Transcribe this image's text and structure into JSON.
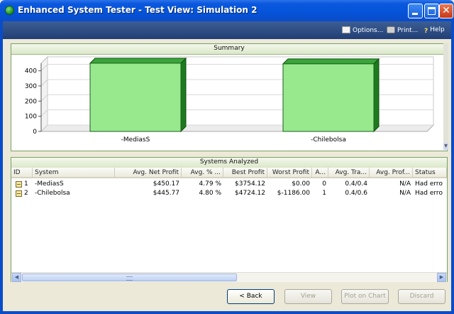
{
  "window": {
    "title": "Enhanced System Tester - Test View: Simulation 2",
    "controls": {
      "minimize_icon": "minimize-icon",
      "maximize_icon": "maximize-icon",
      "close_icon": "close-icon",
      "close_glyph": "✕"
    }
  },
  "toolbar": {
    "options_label": "Options...",
    "print_label": "Print...",
    "help_label": "Help",
    "help_glyph": "?"
  },
  "summary": {
    "header": "Summary"
  },
  "chart_data": {
    "type": "bar",
    "categories": [
      "-MediasS",
      "-Chilebolsa"
    ],
    "values": [
      450.17,
      445.77
    ],
    "ylim": [
      0,
      450
    ],
    "yticks": [
      0,
      100,
      200,
      300,
      400
    ],
    "grid": true,
    "bar_color": "#98e98e",
    "bar_side_color": "#1e7a1e"
  },
  "analyzed": {
    "header": "Systems Analyzed",
    "columns": [
      "ID",
      "System",
      "Avg. Net Profit",
      "Avg. % ...",
      "Best Profit",
      "Worst Profit",
      "A...",
      "Avg. Tra...",
      "Avg. Prof...",
      "Status"
    ],
    "rows": [
      [
        "1",
        "-MediasS",
        "$450.17",
        "4.79 %",
        "$3754.12",
        "$0.00",
        "0",
        "0.4/0.4",
        "N/A",
        "Had erro"
      ],
      [
        "2",
        "-Chilebolsa",
        "$445.77",
        "4.80 %",
        "$4724.12",
        "$-1186.00",
        "1",
        "0.4/0.6",
        "N/A",
        "Had erro"
      ]
    ]
  },
  "buttons": {
    "back": "< Back",
    "view": "View",
    "plot": "Plot on Chart",
    "discard": "Discard"
  }
}
